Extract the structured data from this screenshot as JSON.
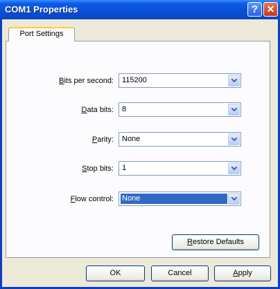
{
  "window": {
    "title": "COM1 Properties"
  },
  "tabs": [
    {
      "label": "Port Settings"
    }
  ],
  "form": {
    "fields": [
      {
        "accel": "B",
        "rest": "its per second:",
        "value": "115200"
      },
      {
        "accel": "D",
        "rest": "ata bits:",
        "value": "8"
      },
      {
        "accel": "P",
        "rest": "arity:",
        "value": "None"
      },
      {
        "accel": "S",
        "rest": "top bits:",
        "value": "1"
      },
      {
        "accel": "F",
        "rest": "low control:",
        "value": "None"
      }
    ]
  },
  "buttons": {
    "restore_accel": "R",
    "restore_rest": "estore Defaults",
    "ok": "OK",
    "cancel": "Cancel",
    "apply_accel": "A",
    "apply_rest": "pply"
  },
  "titlebar_icons": {
    "help": "?",
    "close": "✕"
  },
  "colors": {
    "titlebar": "#0a4fd6",
    "selection": "#316ac5",
    "face": "#ece9d8"
  }
}
